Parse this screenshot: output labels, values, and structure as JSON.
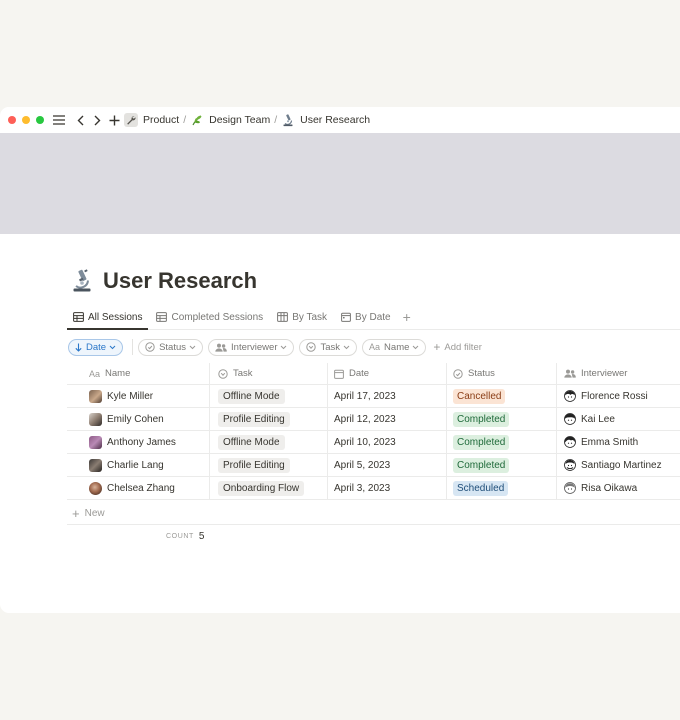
{
  "breadcrumb": {
    "items": [
      {
        "label": "Product",
        "icon": "wrench-icon"
      },
      {
        "label": "Design Team",
        "icon": "herb-icon"
      },
      {
        "label": "User Research",
        "icon": "microscope-icon"
      }
    ],
    "separator": "/"
  },
  "page": {
    "title": "User Research",
    "icon": "microscope-icon"
  },
  "tabs": [
    {
      "label": "All Sessions",
      "icon": "table-icon",
      "active": true
    },
    {
      "label": "Completed Sessions",
      "icon": "table-icon",
      "active": false
    },
    {
      "label": "By Task",
      "icon": "board-icon",
      "active": false
    },
    {
      "label": "By Date",
      "icon": "calendar-icon",
      "active": false
    }
  ],
  "filters": {
    "sort_chip": "Date",
    "chips": [
      "Status",
      "Interviewer",
      "Task",
      "Name"
    ],
    "add_filter": "Add filter"
  },
  "table": {
    "columns": {
      "name": "Name",
      "task": "Task",
      "date": "Date",
      "status": "Status",
      "interviewer": "Interviewer"
    },
    "name_prefix": "Aa",
    "rows": [
      {
        "name": "Kyle Miller",
        "task": "Offline Mode",
        "date": "April 17, 2023",
        "status": "Cancelled",
        "interviewer": "Florence Rossi"
      },
      {
        "name": "Emily Cohen",
        "task": "Profile Editing",
        "date": "April 12, 2023",
        "status": "Completed",
        "interviewer": "Kai Lee"
      },
      {
        "name": "Anthony James",
        "task": "Offline Mode",
        "date": "April 10, 2023",
        "status": "Completed",
        "interviewer": "Emma Smith"
      },
      {
        "name": "Charlie Lang",
        "task": "Profile Editing",
        "date": "April 5, 2023",
        "status": "Completed",
        "interviewer": "Santiago Martinez"
      },
      {
        "name": "Chelsea Zhang",
        "task": "Onboarding Flow",
        "date": "April 3, 2023",
        "status": "Scheduled",
        "interviewer": "Risa Oikawa"
      }
    ],
    "new_label": "New",
    "count_label": "COUNT",
    "count_value": "5"
  },
  "colors": {
    "cover": "#dcdbe1",
    "cancelled_bg": "#fbe4d4",
    "cancelled_fg": "#8a3d16",
    "completed_bg": "#dcefdf",
    "completed_fg": "#1f6a3a",
    "scheduled_bg": "#d7e6f3",
    "scheduled_fg": "#1f4e79",
    "accent": "#2b77c9"
  }
}
